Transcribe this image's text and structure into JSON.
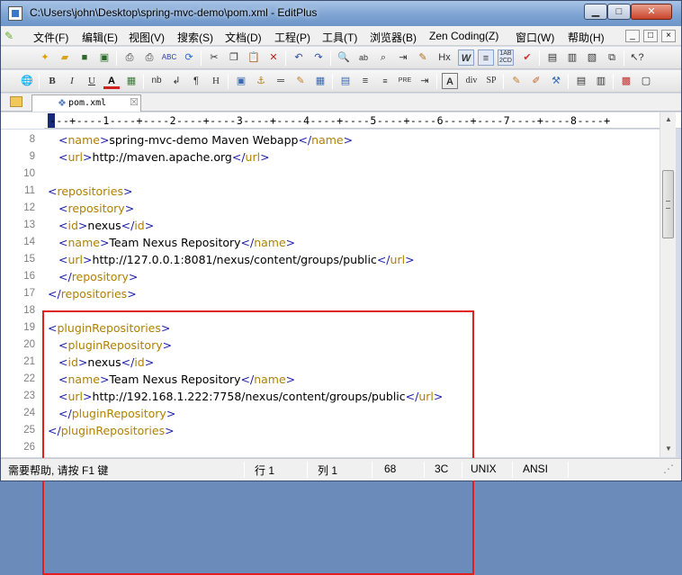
{
  "window": {
    "title": "C:\\Users\\john\\Desktop\\spring-mvc-demo\\pom.xml - EditPlus",
    "minimize_label": "▁",
    "maximize_label": "□",
    "close_label": "✕"
  },
  "menubar": {
    "items": [
      "文件(F)",
      "编辑(E)",
      "视图(V)",
      "搜索(S)",
      "文档(D)",
      "工程(P)",
      "工具(T)",
      "浏览器(B)",
      "Zen Coding(Z)",
      "窗口(W)",
      "帮助(H)"
    ],
    "mdi": [
      "_",
      "□",
      "×"
    ]
  },
  "toolbar1": {
    "icons": [
      "new-file-icon",
      "open-folder-icon",
      "save-icon",
      "save-all-icon",
      "print-preview-icon",
      "print-icon",
      "spell-check-icon",
      "refresh-icon",
      "cut-icon",
      "copy-icon",
      "paste-icon",
      "delete-icon",
      "undo-icon",
      "redo-icon",
      "find-icon",
      "replace-icon",
      "find-in-files-icon",
      "goto-line-icon",
      "html-toolbar-icon",
      "hx-icon",
      "word-wrap-icon",
      "ruler-icon",
      "line-number-icon",
      "check-icon",
      "cliptext-icon",
      "directory-icon",
      "output-icon",
      "full-screen-icon",
      "context-help-icon"
    ],
    "labels": {
      "hx": "Hx",
      "word_wrap": "W"
    }
  },
  "toolbar2": {
    "labels": {
      "bold": "B",
      "italic": "I",
      "underline": "U",
      "font": "A",
      "nbsp": "nb",
      "br": "↲",
      "para": "¶",
      "heading": "H",
      "image": "▣",
      "anchor": "⚓",
      "hr": "═",
      "comment": "✎",
      "table": "▦",
      "form": "▤",
      "list": "≡",
      "pre": "PRE",
      "entity": "A",
      "div": "div",
      "span": "SP"
    }
  },
  "tab": {
    "label": "pom.xml",
    "close_label": "☒"
  },
  "ruler": {
    "text": "---+----1----+----2----+----3----+----4----+----5----+----6----+----7----+----8----+"
  },
  "editor": {
    "lines": [
      {
        "n": "8",
        "indent": 1,
        "parts": [
          [
            "br",
            "<"
          ],
          [
            "tag",
            "name"
          ],
          [
            "br",
            ">"
          ],
          [
            "txt",
            "spring-mvc-demo Maven Webapp"
          ],
          [
            "br",
            "</"
          ],
          [
            "tag",
            "name"
          ],
          [
            "br",
            ">"
          ]
        ]
      },
      {
        "n": "9",
        "indent": 1,
        "parts": [
          [
            "br",
            "<"
          ],
          [
            "tag",
            "url"
          ],
          [
            "br",
            ">"
          ],
          [
            "txt",
            "http://maven.apache.org"
          ],
          [
            "br",
            "</"
          ],
          [
            "tag",
            "url"
          ],
          [
            "br",
            ">"
          ]
        ]
      },
      {
        "n": "10",
        "indent": 0,
        "parts": []
      },
      {
        "n": "11",
        "indent": 0,
        "parts": [
          [
            "br",
            "<"
          ],
          [
            "tag",
            "repositories"
          ],
          [
            "br",
            ">"
          ]
        ]
      },
      {
        "n": "12",
        "indent": 1,
        "parts": [
          [
            "br",
            "<"
          ],
          [
            "tag",
            "repository"
          ],
          [
            "br",
            ">"
          ]
        ]
      },
      {
        "n": "13",
        "indent": 1,
        "parts": [
          [
            "br",
            "<"
          ],
          [
            "tag",
            "id"
          ],
          [
            "br",
            ">"
          ],
          [
            "txt",
            "nexus"
          ],
          [
            "br",
            "</"
          ],
          [
            "tag",
            "id"
          ],
          [
            "br",
            ">"
          ]
        ]
      },
      {
        "n": "14",
        "indent": 1,
        "parts": [
          [
            "br",
            "<"
          ],
          [
            "tag",
            "name"
          ],
          [
            "br",
            ">"
          ],
          [
            "txt",
            "Team Nexus Repository"
          ],
          [
            "br",
            "</"
          ],
          [
            "tag",
            "name"
          ],
          [
            "br",
            ">"
          ]
        ]
      },
      {
        "n": "15",
        "indent": 1,
        "parts": [
          [
            "br",
            "<"
          ],
          [
            "tag",
            "url"
          ],
          [
            "br",
            ">"
          ],
          [
            "txt",
            "http://127.0.0.1:8081/nexus/content/groups/public"
          ],
          [
            "br",
            "</"
          ],
          [
            "tag",
            "url"
          ],
          [
            "br",
            ">"
          ]
        ]
      },
      {
        "n": "16",
        "indent": 1,
        "parts": [
          [
            "br",
            "</"
          ],
          [
            "tag",
            "repository"
          ],
          [
            "br",
            ">"
          ]
        ]
      },
      {
        "n": "17",
        "indent": 0,
        "parts": [
          [
            "br",
            "</"
          ],
          [
            "tag",
            "repositories"
          ],
          [
            "br",
            ">"
          ]
        ]
      },
      {
        "n": "18",
        "indent": 0,
        "parts": []
      },
      {
        "n": "19",
        "indent": 0,
        "parts": [
          [
            "br",
            "<"
          ],
          [
            "tag",
            "pluginRepositories"
          ],
          [
            "br",
            ">"
          ]
        ]
      },
      {
        "n": "20",
        "indent": 1,
        "parts": [
          [
            "br",
            "<"
          ],
          [
            "tag",
            "pluginRepository"
          ],
          [
            "br",
            ">"
          ]
        ]
      },
      {
        "n": "21",
        "indent": 1,
        "parts": [
          [
            "br",
            "<"
          ],
          [
            "tag",
            "id"
          ],
          [
            "br",
            ">"
          ],
          [
            "txt",
            "nexus"
          ],
          [
            "br",
            "</"
          ],
          [
            "tag",
            "id"
          ],
          [
            "br",
            ">"
          ]
        ]
      },
      {
        "n": "22",
        "indent": 1,
        "parts": [
          [
            "br",
            "<"
          ],
          [
            "tag",
            "name"
          ],
          [
            "br",
            ">"
          ],
          [
            "txt",
            "Team Nexus Repository"
          ],
          [
            "br",
            "</"
          ],
          [
            "tag",
            "name"
          ],
          [
            "br",
            ">"
          ]
        ]
      },
      {
        "n": "23",
        "indent": 1,
        "parts": [
          [
            "br",
            "<"
          ],
          [
            "tag",
            "url"
          ],
          [
            "br",
            ">"
          ],
          [
            "txt",
            "http://192.168.1.222:7758/nexus/content/groups/public"
          ],
          [
            "br",
            "</"
          ],
          [
            "tag",
            "url"
          ],
          [
            "br",
            ">"
          ]
        ]
      },
      {
        "n": "24",
        "indent": 1,
        "parts": [
          [
            "br",
            "</"
          ],
          [
            "tag",
            "pluginRepository"
          ],
          [
            "br",
            ">"
          ]
        ]
      },
      {
        "n": "25",
        "indent": 0,
        "parts": [
          [
            "br",
            "</"
          ],
          [
            "tag",
            "pluginRepositories"
          ],
          [
            "br",
            ">"
          ]
        ]
      },
      {
        "n": "26",
        "indent": 0,
        "parts": []
      }
    ]
  },
  "statusbar": {
    "help": "需要帮助, 请按 F1 键",
    "line": "行 1",
    "col": "列 1",
    "chars": "68",
    "hex": "3C",
    "eol": "UNIX",
    "encoding": "ANSI"
  },
  "colors": {
    "tag": "#b08000",
    "bracket": "#1a1aa8",
    "highlight_box": "#e02020"
  }
}
